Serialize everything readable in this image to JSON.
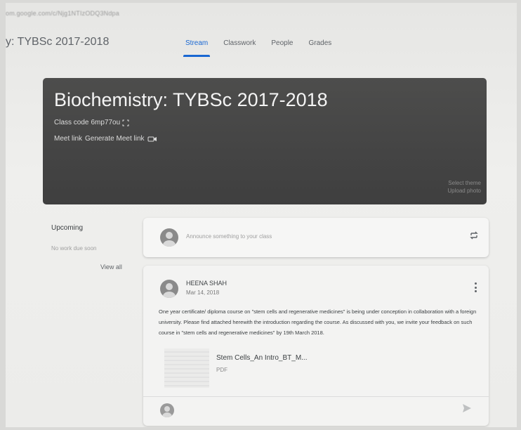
{
  "browser": {
    "url": "om.google.com/c/Njg1NTIzODQ3Ndpa"
  },
  "header": {
    "class_name": "y: TYBSc 2017-2018",
    "tabs": [
      {
        "label": "Stream",
        "active": true
      },
      {
        "label": "Classwork",
        "active": false
      },
      {
        "label": "People",
        "active": false
      },
      {
        "label": "Grades",
        "active": false
      }
    ]
  },
  "banner": {
    "title": "Biochemistry: TYBSc 2017-2018",
    "class_code_label": "Class code",
    "class_code": "6mp77ou",
    "meet_link_label": "Meet link",
    "generate_meet_link": "Generate Meet link",
    "select_theme": "Select theme",
    "upload_photo": "Upload photo"
  },
  "upcoming": {
    "title": "Upcoming",
    "empty_text": "No work due soon",
    "view_all": "View all"
  },
  "announce": {
    "placeholder": "Announce something to your class"
  },
  "post": {
    "author": "HEENA SHAH",
    "date": "Mar 14, 2018",
    "body": "One year certificate/ diploma course on \"stem cells and regenerative medicines\" is being under conception in collaboration with a foreign university. Please find attached herewith the introduction regarding the course. As discussed with you, we invite your feedback on such course in \"stem cells and regenerative medicines\" by 19th March 2018.",
    "attachment": {
      "name": "Stem Cells_An Intro_BT_M...",
      "type": "PDF"
    }
  },
  "colors": {
    "accent": "#1967d2",
    "banner": "#474747"
  },
  "icons": [
    "copy-icon",
    "video-camera-icon",
    "repost-icon",
    "more-vert-icon",
    "avatar-icon",
    "send-icon"
  ]
}
